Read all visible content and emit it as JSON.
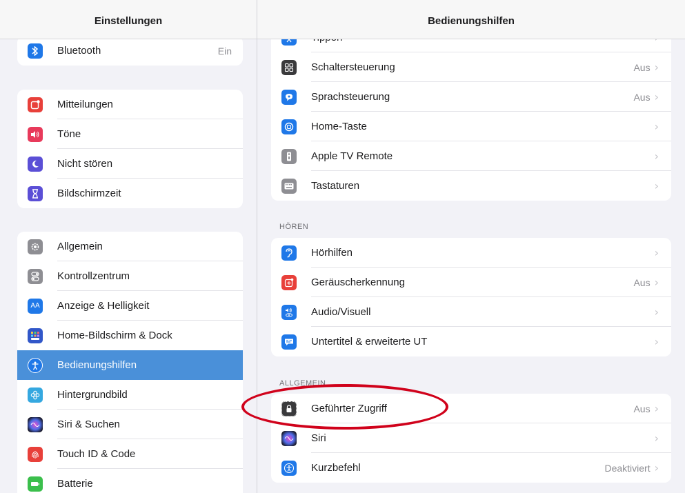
{
  "left": {
    "title": "Einstellungen",
    "group1": [
      {
        "label": "Bluetooth",
        "value": "Ein",
        "icon": "bluetooth-icon",
        "color": "#1f78e8"
      }
    ],
    "group2": [
      {
        "label": "Mitteilungen",
        "icon": "notifications-icon",
        "color": "#e8403a"
      },
      {
        "label": "Töne",
        "icon": "speaker-icon",
        "color": "#e83a5b"
      },
      {
        "label": "Nicht stören",
        "icon": "moon-icon",
        "color": "#5b4fd6"
      },
      {
        "label": "Bildschirmzeit",
        "icon": "hourglass-icon",
        "color": "#5b4fd6"
      }
    ],
    "group3": [
      {
        "label": "Allgemein",
        "icon": "gear-icon",
        "color": "#8e8e93"
      },
      {
        "label": "Kontrollzentrum",
        "icon": "toggles-icon",
        "color": "#8e8e93"
      },
      {
        "label": "Anzeige & Helligkeit",
        "icon": "text-size-icon",
        "color": "#1f78e8"
      },
      {
        "label": "Home-Bildschirm & Dock",
        "icon": "app-grid-icon",
        "color": "#3157c9"
      },
      {
        "label": "Bedienungshilfen",
        "icon": "accessibility-icon",
        "color": "#1f78e8",
        "selected": true
      },
      {
        "label": "Hintergrundbild",
        "icon": "flower-icon",
        "color": "#35a8e0"
      },
      {
        "label": "Siri & Suchen",
        "icon": "siri-icon",
        "color": "#2a2a3a"
      },
      {
        "label": "Touch ID & Code",
        "icon": "fingerprint-icon",
        "color": "#e8403a"
      },
      {
        "label": "Batterie",
        "icon": "battery-icon",
        "color": "#3bbf4c"
      }
    ]
  },
  "right": {
    "title": "Bedienungshilfen",
    "group1": [
      {
        "label": "Tippen",
        "icon": "tap-icon",
        "color": "#1f78e8"
      },
      {
        "label": "Schaltersteuerung",
        "value": "Aus",
        "icon": "switch-grid-icon",
        "color": "#3a3a3c"
      },
      {
        "label": "Sprachsteuerung",
        "value": "Aus",
        "icon": "voice-control-icon",
        "color": "#1f78e8"
      },
      {
        "label": "Home-Taste",
        "icon": "home-button-icon",
        "color": "#1f78e8"
      },
      {
        "label": "Apple TV Remote",
        "icon": "remote-icon",
        "color": "#8e8e93"
      },
      {
        "label": "Tastaturen",
        "icon": "keyboard-icon",
        "color": "#8e8e93"
      }
    ],
    "hearing_header": "HÖREN",
    "group2": [
      {
        "label": "Hörhilfen",
        "icon": "ear-icon",
        "color": "#1f78e8"
      },
      {
        "label": "Geräuscherkennung",
        "value": "Aus",
        "icon": "sound-recognition-icon",
        "color": "#e8403a"
      },
      {
        "label": "Audio/Visuell",
        "icon": "audio-visual-icon",
        "color": "#1f78e8"
      },
      {
        "label": "Untertitel & erweiterte UT",
        "icon": "subtitles-icon",
        "color": "#1f78e8"
      }
    ],
    "general_header": "ALLGEMEIN",
    "group3": [
      {
        "label": "Geführter Zugriff",
        "value": "Aus",
        "icon": "lock-icon",
        "color": "#3a3a3c"
      },
      {
        "label": "Siri",
        "icon": "siri-icon",
        "color": "#2a2a3a"
      },
      {
        "label": "Kurzbefehl",
        "value": "Deaktiviert",
        "icon": "accessibility-icon",
        "color": "#1f78e8"
      }
    ]
  },
  "chevron": "›"
}
